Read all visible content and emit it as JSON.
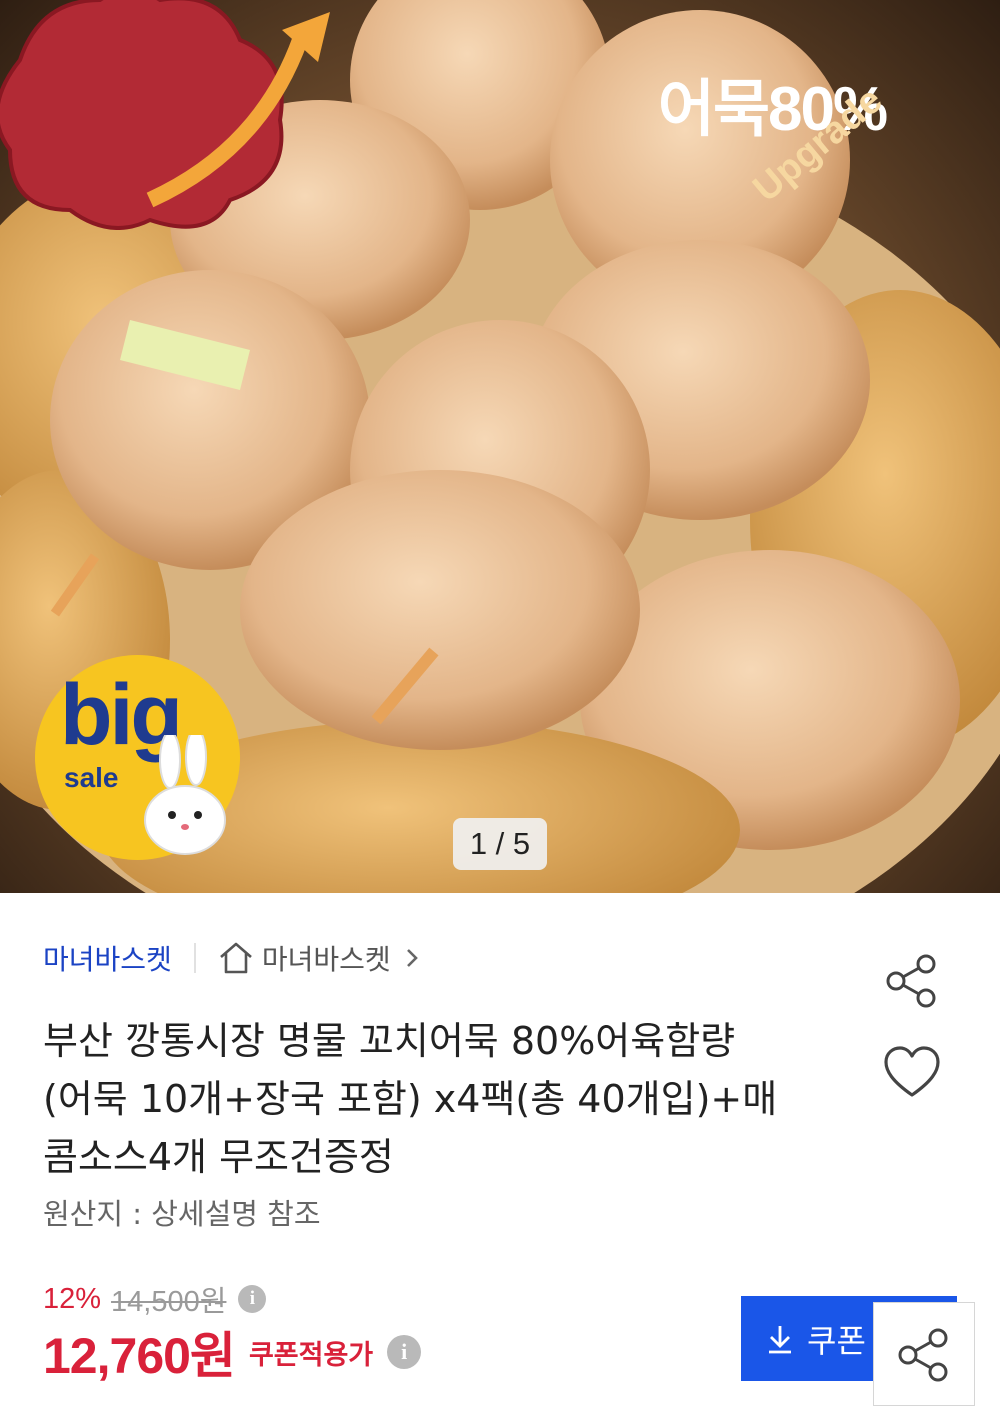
{
  "hero": {
    "image_counter": "1 / 5",
    "badge_text": "어묵80%",
    "badge_subtext": "Upgrade",
    "sale_badge_main": "big",
    "sale_badge_sub": "sale"
  },
  "seller": {
    "name": "마녀바스켓",
    "store_link_label": "마녀바스켓"
  },
  "product": {
    "title_lines": [
      "부산 깡통시장 명물 꼬치어묵 80%어육함량",
      "(어묵 10개+장국 포함) x4팩(총 40개입)+매",
      "콤소스4개 무조건증정"
    ],
    "origin": "원산지 : 상세설명 참조"
  },
  "pricing": {
    "discount_rate": "12%",
    "original_price": "14,500원",
    "final_price": "12,760원",
    "final_price_label": "쿠폰적용가"
  },
  "actions": {
    "coupon_button_label": "쿠폰"
  },
  "icons": {
    "info": "i"
  },
  "colors": {
    "brand_blue": "#1b43c4",
    "coupon_blue": "#1a56e8",
    "price_red": "#d9213a"
  }
}
